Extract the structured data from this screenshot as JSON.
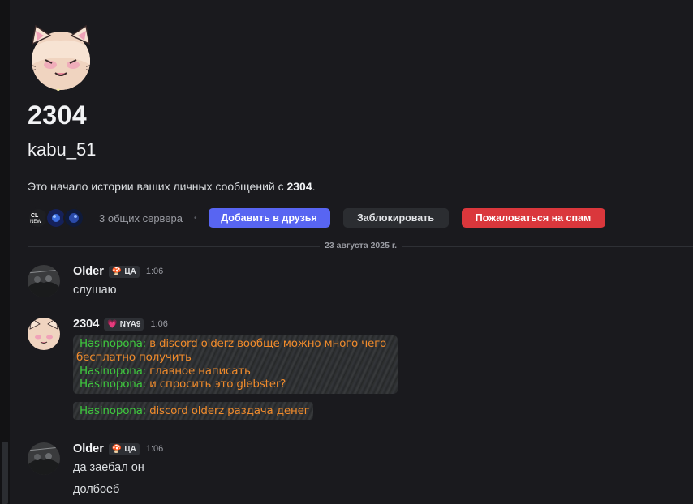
{
  "profile": {
    "display_name": "2304",
    "username": "kabu_51",
    "intro_prefix": "Это начало истории ваших личных сообщений с ",
    "intro_name": "2304",
    "intro_suffix": "."
  },
  "actions": {
    "mutual_servers": "3 общих сервера",
    "dot": "•",
    "add_friend": "Добавить в друзья",
    "block": "Заблокировать",
    "report_spam": "Пожаловаться на спам"
  },
  "divider": {
    "date": "23 августа 2025 г."
  },
  "messages": [
    {
      "author": "Older",
      "tag_icon": "🍄",
      "tag": "ЦА",
      "time": "1:06",
      "lines": [
        "слушаю"
      ]
    },
    {
      "author": "2304",
      "tag_icon": "💗",
      "tag": "NYA9",
      "time": "1:06",
      "embed": {
        "line1_name": "Hasinopona:",
        "line1_text": " в discord olderz вообще можно много чего",
        "line1_cont": "бесплатно получить",
        "line2_name": "Hasinopona:",
        "line2_text": " главное написать",
        "line3_name": "Hasinopona:",
        "line3_text": " и спросить это glebster?"
      },
      "embed2": {
        "name": "Hasinopona:",
        "text": " discord olderz раздача денег"
      }
    },
    {
      "author": "Older",
      "tag_icon": "🍄",
      "tag": "ЦА",
      "time": "1:06",
      "lines": [
        "да заебал он",
        "долбоеб"
      ]
    }
  ],
  "colors": {
    "accent": "#5865f2",
    "danger": "#da373c",
    "embed_name": "#3ec93e",
    "embed_text": "#f08b2c"
  },
  "icons": {
    "big_avatar": "cat-ears-avatar-icon",
    "server_icons": [
      "server-icon-clnew",
      "server-icon-blue-1",
      "server-icon-blue-2"
    ]
  }
}
